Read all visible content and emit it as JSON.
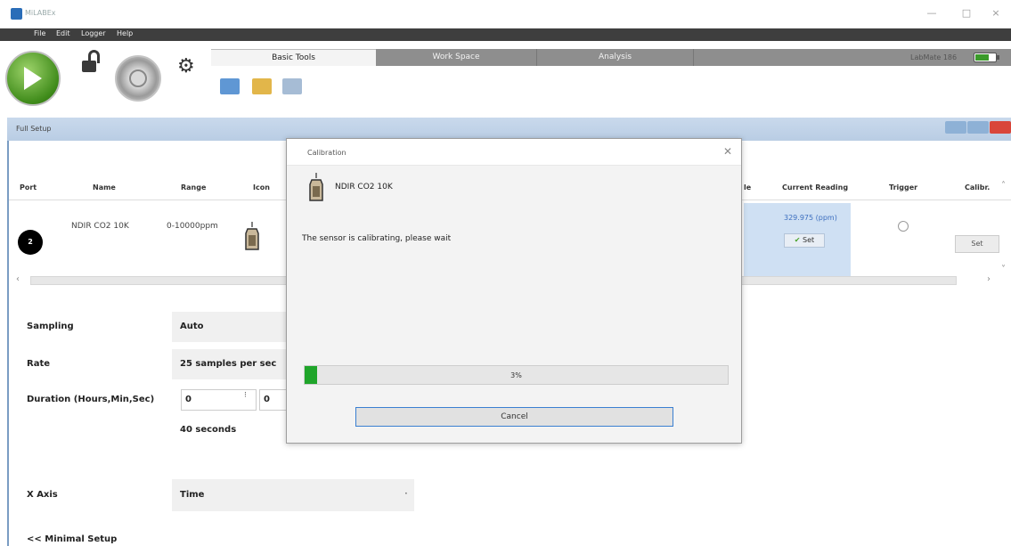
{
  "window": {
    "title": "MiLABEx",
    "controls": [
      "—",
      "□",
      "×"
    ]
  },
  "menu": [
    "File",
    "Edit",
    "Logger",
    "Help"
  ],
  "tabs": [
    {
      "label": "Basic Tools",
      "active": true
    },
    {
      "label": "Work Space",
      "active": false
    },
    {
      "label": "Analysis",
      "active": false
    }
  ],
  "device": {
    "label": "LabMate 186"
  },
  "setup": {
    "title": "Full Setup",
    "columns": [
      "Port",
      "Name",
      "Range",
      "Icon",
      "le",
      "Current Reading",
      "Trigger",
      "Calibr."
    ],
    "row": {
      "port": "2",
      "name": "NDIR CO2 10K",
      "range": "0-10000ppm",
      "current_reading": "329.975 (ppm)",
      "set_label": "Set",
      "calibrate_set_label": "Set"
    }
  },
  "form": {
    "sampling": {
      "label": "Sampling",
      "value": "Auto"
    },
    "rate": {
      "label": "Rate",
      "value": "25 samples per sec"
    },
    "duration": {
      "label": "Duration (Hours,Min,Sec)",
      "hours": "0",
      "minutes": "0",
      "summary": "40 seconds"
    },
    "x_axis": {
      "label": "X Axis",
      "value": "Time"
    },
    "minimal_link": "<< Minimal Setup"
  },
  "dialog": {
    "title": "Calibration",
    "sensor": "NDIR CO2 10K",
    "message": "The sensor is calibrating, please wait",
    "progress_label": "3%",
    "progress_value": 3,
    "cancel_label": "Cancel"
  }
}
